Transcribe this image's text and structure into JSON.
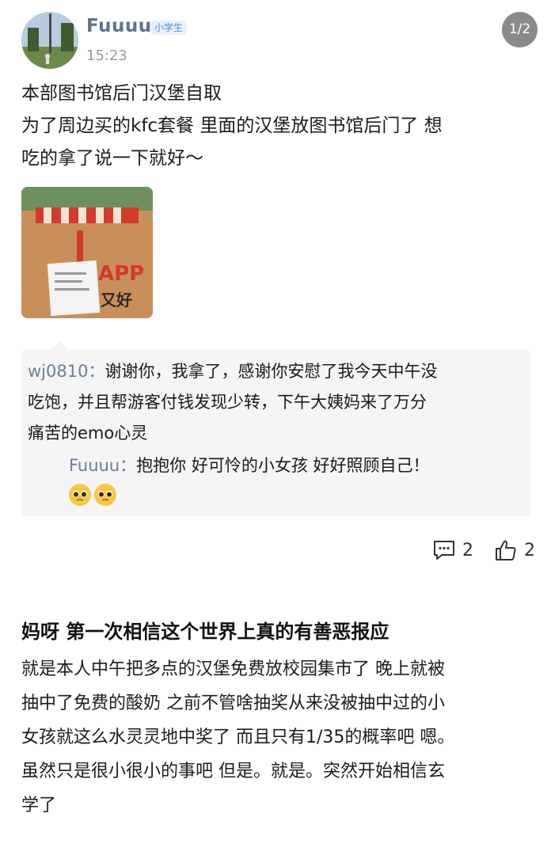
{
  "post": {
    "user": "Fuuuu",
    "badge": "小学生",
    "time": "15:23",
    "page_indicator": "1/2",
    "lines": [
      "本部图书馆后门汉堡自取",
      "为了周边买的kfc套餐 里面的汉堡放图书馆后门了 想",
      "吃的拿了说一下就好～"
    ],
    "image": {
      "app_text": "APP",
      "bag_text": "又好"
    }
  },
  "comments": {
    "first": {
      "user": "wj0810",
      "lines": [
        "谢谢你，我拿了，感谢你安慰了我今天中午没",
        "吃饱，并且帮游客付钱发现少转，下午大姨妈来了万分",
        "痛苦的emo心灵"
      ]
    },
    "reply": {
      "user": "Fuuuu",
      "text": "抱抱你 好可怜的小女孩 好好照顾自己！"
    },
    "colon": "："
  },
  "actions": {
    "comments_count": "2",
    "likes_count": "2"
  },
  "post2": {
    "title": "妈呀 第一次相信这个世界上真的有善恶报应",
    "lines": [
      "就是本人中午把多点的汉堡免费放校园集市了 晚上就被",
      "抽中了免费的酸奶 之前不管啥抽奖从来没被抽中过的小",
      "女孩就这么水灵灵地中奖了 而且只有1/35的概率吧 嗯。",
      "虽然只是很小很小的事吧 但是。就是。突然开始相信玄",
      "学了"
    ]
  }
}
